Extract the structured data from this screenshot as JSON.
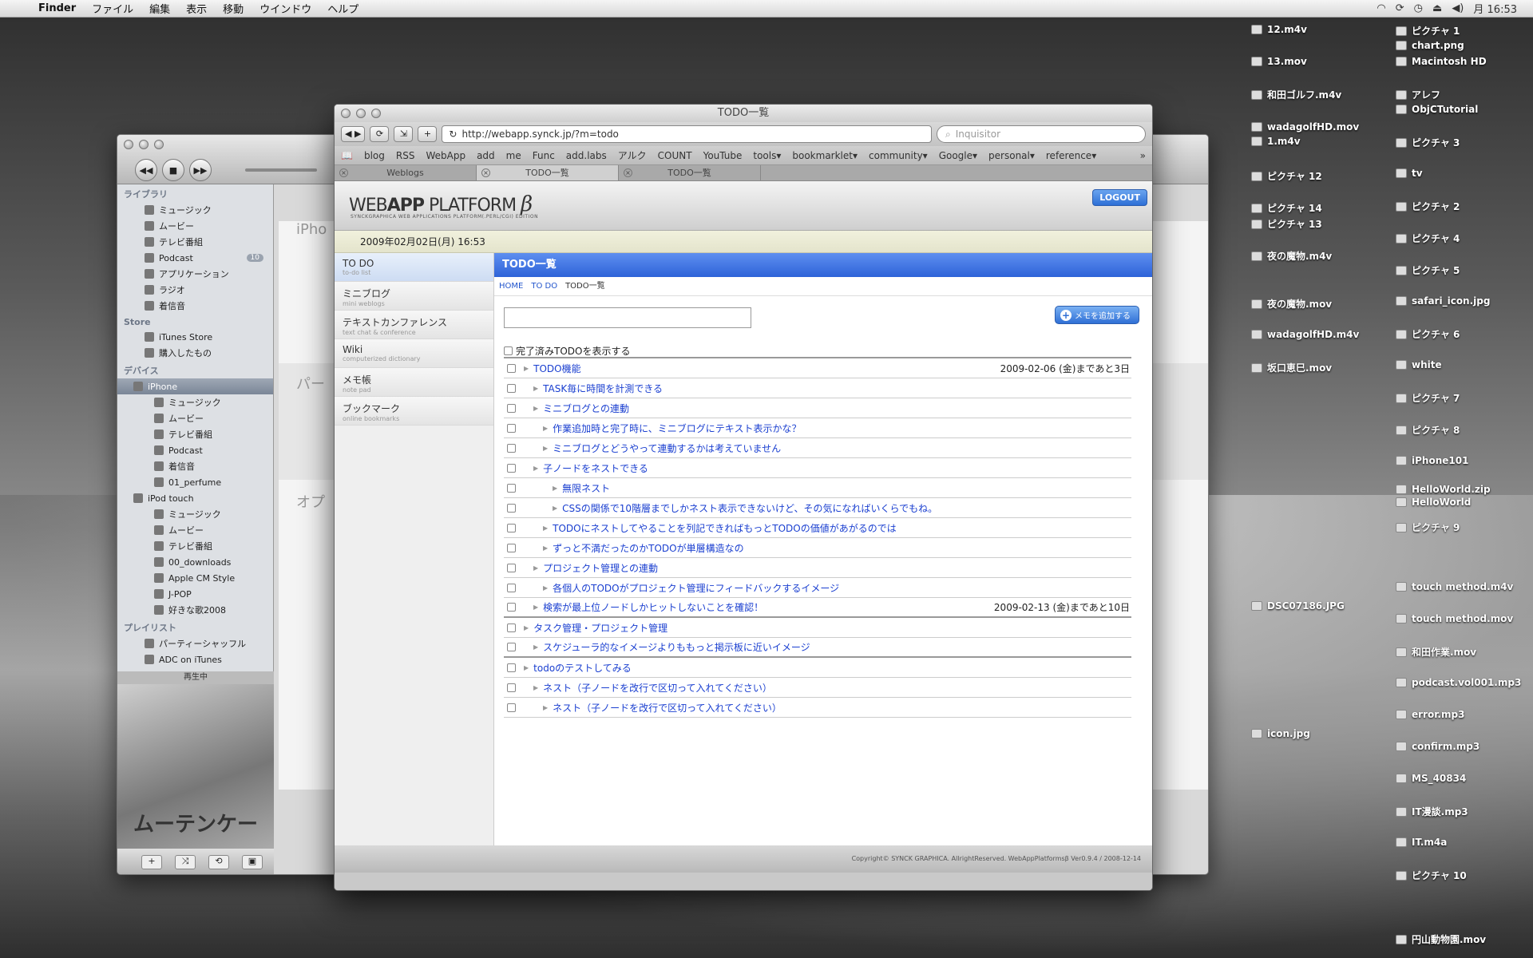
{
  "menubar": {
    "app": "Finder",
    "items": [
      "ファイル",
      "編集",
      "表示",
      "移動",
      "ウインドウ",
      "ヘルプ"
    ],
    "clock": "月 16:53"
  },
  "desktop": {
    "col1": [
      "12.m4v",
      "13.mov",
      "和田ゴルフ.m4v",
      "wadagolfHD.mov",
      "1.m4v",
      "ピクチャ 12",
      "ピクチャ 14",
      "ピクチャ 13",
      "夜の魔物.m4v",
      "夜の魔物.mov",
      "wadagolfHD.m4v",
      "坂口恵巳.mov",
      "DSC07186.JPG",
      "icon.jpg"
    ],
    "col2": [
      "ピクチャ 1",
      "chart.png",
      "Macintosh HD",
      "アレフ",
      "ObjCTutorial",
      "ピクチャ 3",
      "tv",
      "ピクチャ 2",
      "ピクチャ 4",
      "ピクチャ 5",
      "safari_icon.jpg",
      "ピクチャ 6",
      "white",
      "ピクチャ 7",
      "ピクチャ 8",
      "iPhone101",
      "HelloWorld.zip",
      "HelloWorld",
      "ピクチャ 9",
      "touch method.m4v",
      "touch method.mov",
      "和田作業.mov",
      "podcast.vol001.mp3",
      "error.mp3",
      "confirm.mp3",
      "MS_40834",
      "IT漫談.mp3",
      "IT.m4a",
      "ピクチャ 10",
      "円山動物園.mov"
    ]
  },
  "itunes": {
    "library_header": "ライブラリ",
    "library": [
      "ミュージック",
      "ムービー",
      "テレビ番組",
      "Podcast",
      "アプリケーション",
      "ラジオ",
      "着信音"
    ],
    "podcast_badge": "10",
    "store_header": "Store",
    "store": [
      "iTunes Store",
      "購入したもの"
    ],
    "devices_header": "デバイス",
    "iphone": "iPhone",
    "iphone_items": [
      "ミュージック",
      "ムービー",
      "テレビ番組",
      "Podcast",
      "着信音",
      "01_perfume"
    ],
    "ipod": "iPod touch",
    "ipod_items": [
      "ミュージック",
      "ムービー",
      "テレビ番組",
      "00_downloads",
      "Apple CM Style",
      "J-POP",
      "好きな歌2008"
    ],
    "playlist_header": "プレイリスト",
    "playlists": [
      "パーティーシャッフル",
      "ADC on iTunes"
    ],
    "now_playing": "再生中",
    "album_text": "ムーテンケー",
    "main_labels": [
      "iPho",
      "パー",
      "オプ"
    ]
  },
  "safari": {
    "title": "TODO一覧",
    "url": "http://webapp.synck.jp/?m=todo",
    "search_placeholder": "Inquisitor",
    "bookmarks": [
      "blog",
      "RSS",
      "WebApp",
      "add",
      "me",
      "Func",
      "add.labs",
      "アルク",
      "COUNT",
      "YouTube",
      "tools▾",
      "bookmarklet▾",
      "community▾",
      "Google▾",
      "personal▾",
      "reference▾"
    ],
    "tabs": [
      "Weblogs",
      "TODO一覧",
      "TODO一覧"
    ]
  },
  "webapp": {
    "logo_a": "WEB",
    "logo_b": "APP",
    "logo_c": " PLATFORM",
    "logo_beta": "β",
    "logo_sub": "SYNCKGRAPHICA WEB APPLICATIONS PLATFORM(.PERL/CGI) EDITION",
    "logout": "LOGOUT",
    "datetime": "2009年02月02日(月) 16:53",
    "nav": [
      {
        "t": "TO DO",
        "s": "to-do list"
      },
      {
        "t": "ミニブログ",
        "s": "mini weblogs"
      },
      {
        "t": "テキストカンファレンス",
        "s": "text chat & conference"
      },
      {
        "t": "Wiki",
        "s": "computerized dictionary"
      },
      {
        "t": "メモ帳",
        "s": "note pad"
      },
      {
        "t": "ブックマーク",
        "s": "online bookmarks"
      }
    ],
    "content_title": "TODO一覧",
    "breadcrumb": [
      "HOME",
      "TO DO",
      "TODO一覧"
    ],
    "add_memo": "メモを追加する",
    "show_done": "完了済みTODOを表示する",
    "todos": [
      {
        "text": "TODO機能",
        "level": 0,
        "due": "2009-02-06 (金)まであと3日"
      },
      {
        "text": "TASK毎に時間を計測できる",
        "level": 1,
        "due": ""
      },
      {
        "text": "ミニブログとの連動",
        "level": 1,
        "due": ""
      },
      {
        "text": "作業追加時と完了時に、ミニブログにテキスト表示かな？",
        "level": 2,
        "due": ""
      },
      {
        "text": "ミニブログとどうやって連動するかは考えていません",
        "level": 2,
        "due": ""
      },
      {
        "text": "子ノードをネストできる",
        "level": 1,
        "due": ""
      },
      {
        "text": "無限ネスト",
        "level": 3,
        "due": ""
      },
      {
        "text": "CSSの関係で10階層までしかネスト表示できないけど、その気になればいくらでもね。",
        "level": 3,
        "due": ""
      },
      {
        "text": "TODOにネストしてやることを列記できればもっとTODOの価値があがるのでは",
        "level": 2,
        "due": ""
      },
      {
        "text": "ずっと不満だったのかTODOが単層構造なの",
        "level": 2,
        "due": ""
      },
      {
        "text": "プロジェクト管理との連動",
        "level": 1,
        "due": ""
      },
      {
        "text": "各個人のTODOがプロジェクト管理にフィードバックするイメージ",
        "level": 2,
        "due": ""
      },
      {
        "text": "検索が最上位ノードしかヒットしないことを確認！",
        "level": 1,
        "due": "2009-02-13 (金)まであと10日"
      },
      {
        "text": "タスク管理・プロジェクト管理",
        "level": 0,
        "due": ""
      },
      {
        "text": "スケジューラ的なイメージよりももっと掲示板に近いイメージ",
        "level": 1,
        "due": ""
      },
      {
        "text": "todoのテストしてみる",
        "level": 0,
        "due": ""
      },
      {
        "text": "ネスト（子ノードを改行で区切って入れてください）",
        "level": 1,
        "due": ""
      },
      {
        "text": "ネスト（子ノードを改行で区切って入れてください）",
        "level": 2,
        "due": ""
      }
    ],
    "footer": "Copyright© SYNCK GRAPHICA. AllrightReserved. WebAppPlatformsβ Ver0.9.4 / 2008-12-14"
  }
}
